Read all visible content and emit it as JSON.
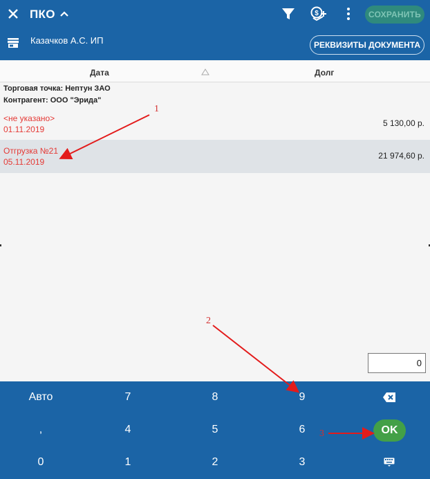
{
  "header": {
    "title": "ПКО",
    "save_label": "СОХРАНИТЬ",
    "company": "Казачков А.С. ИП",
    "requisites_label": "РЕКВИЗИТЫ ДОКУМЕНТА"
  },
  "table": {
    "col_date": "Дата",
    "col_debt": "Долг",
    "outlet": "Торговая точка: Нептун ЗАО",
    "counterparty": "Контрагент: ООО \"Эрида\"",
    "rows": [
      {
        "name": "<не указано>",
        "date": "01.11.2019",
        "amount": "5 130,00 р."
      },
      {
        "name": "Отгрузка №21",
        "date": "05.11.2019",
        "amount": "21 974,60 р."
      }
    ]
  },
  "input_value": "0",
  "keypad": {
    "keys": [
      "Авто",
      "7",
      "8",
      "9",
      ",",
      "4",
      "5",
      "6",
      "0",
      "1",
      "2",
      "3"
    ],
    "ok_label": "OK"
  },
  "annotations": [
    "1",
    "2",
    "3"
  ]
}
